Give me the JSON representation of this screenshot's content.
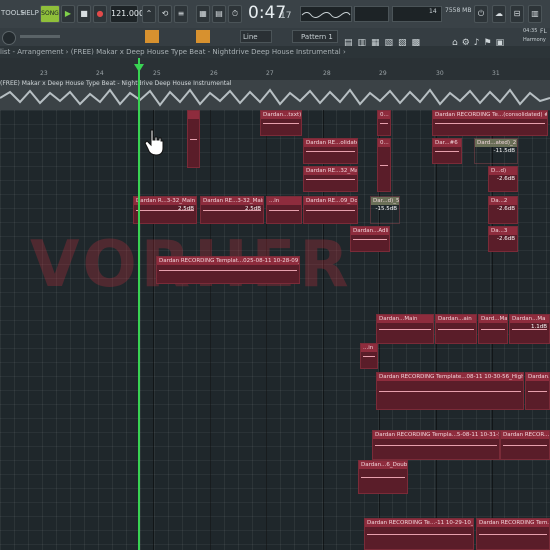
{
  "toolbar": {
    "menu_tools": "TOOLS",
    "menu_help": "HELP",
    "song_mode": "SONG",
    "tempo": "121.000",
    "time": "0:47",
    "time_sub": "17",
    "cpu_value": "14",
    "ram_value": "7558 MB",
    "snap_value": "Line",
    "pattern_name": "Pattern 1",
    "right_label_1": "04:35",
    "right_label_2": "FL",
    "right_label_3": "Harmony"
  },
  "window": {
    "title": "list - Arrangement › (FREE) Makar x Deep House Type Beat - Nightdrive  Deep House Instrumental ›"
  },
  "ruler": {
    "ticks": [
      "23",
      "24",
      "25",
      "26",
      "27",
      "28",
      "29",
      "30",
      "31"
    ]
  },
  "overview": {
    "title": "(FREE) Makar x Deep House Type Beat - Nightdrive  Deep House Instrumental"
  },
  "watermark": "VORHER",
  "clips": [
    {
      "label": "",
      "db": ""
    },
    {
      "label": "Dardan...txxt) #5",
      "db": ""
    },
    {
      "label": "Dardan RECORDING Te...(consolidated) #5",
      "db": ""
    },
    {
      "label": "0...",
      "db": ""
    },
    {
      "label": "Dar...#6",
      "db": ""
    },
    {
      "label": "Dard...ated)_2",
      "db": "-11.5dB"
    },
    {
      "label": "Dardan RE...olidated)",
      "db": ""
    },
    {
      "label": "Dardan RE...32_Main",
      "db": ""
    },
    {
      "label": "0...",
      "db": ""
    },
    {
      "label": "D...d)",
      "db": "-2.6dB"
    },
    {
      "label": "Dardan R...3-32_Main",
      "db": "2.5dB"
    },
    {
      "label": "Dardan RE...3-32_Main",
      "db": "2.5dB"
    },
    {
      "label": "...in",
      "db": ""
    },
    {
      "label": "Dardan RE...09_Double",
      "db": ""
    },
    {
      "label": "Dar...d)_5",
      "db": "-15.5dB"
    },
    {
      "label": "Da...2",
      "db": "-2.6dB"
    },
    {
      "label": "Dardan...Adlibs",
      "db": ""
    },
    {
      "label": "Da...3",
      "db": "-2.6dB"
    },
    {
      "label": "Dardan RECORDING Templat...025-08-11 10-28-09_Double",
      "db": ""
    },
    {
      "label": "Dardan...Main",
      "db": ""
    },
    {
      "label": "Dardan...ain",
      "db": ""
    },
    {
      "label": "Dard...Main",
      "db": ""
    },
    {
      "label": "Dardan...Ma",
      "db": "1.1dB"
    },
    {
      "label": "...in",
      "db": ""
    },
    {
      "label": "Dardan RECORDING Template...08-11 10-30-56_High Double",
      "db": ""
    },
    {
      "label": "Dardan...",
      "db": ""
    },
    {
      "label": "Dardan RECORDING Templa...5-08-11 10-31-56_Dou",
      "db": ""
    },
    {
      "label": "Dardan RECOR...32-5",
      "db": ""
    },
    {
      "label": "Dardan...6_Double",
      "db": ""
    },
    {
      "label": "Dardan RECORDING Te...-11 10-29-10_Adlibs",
      "db": ""
    },
    {
      "label": "Dardan RECORDING Tem...08-1",
      "db": ""
    }
  ]
}
